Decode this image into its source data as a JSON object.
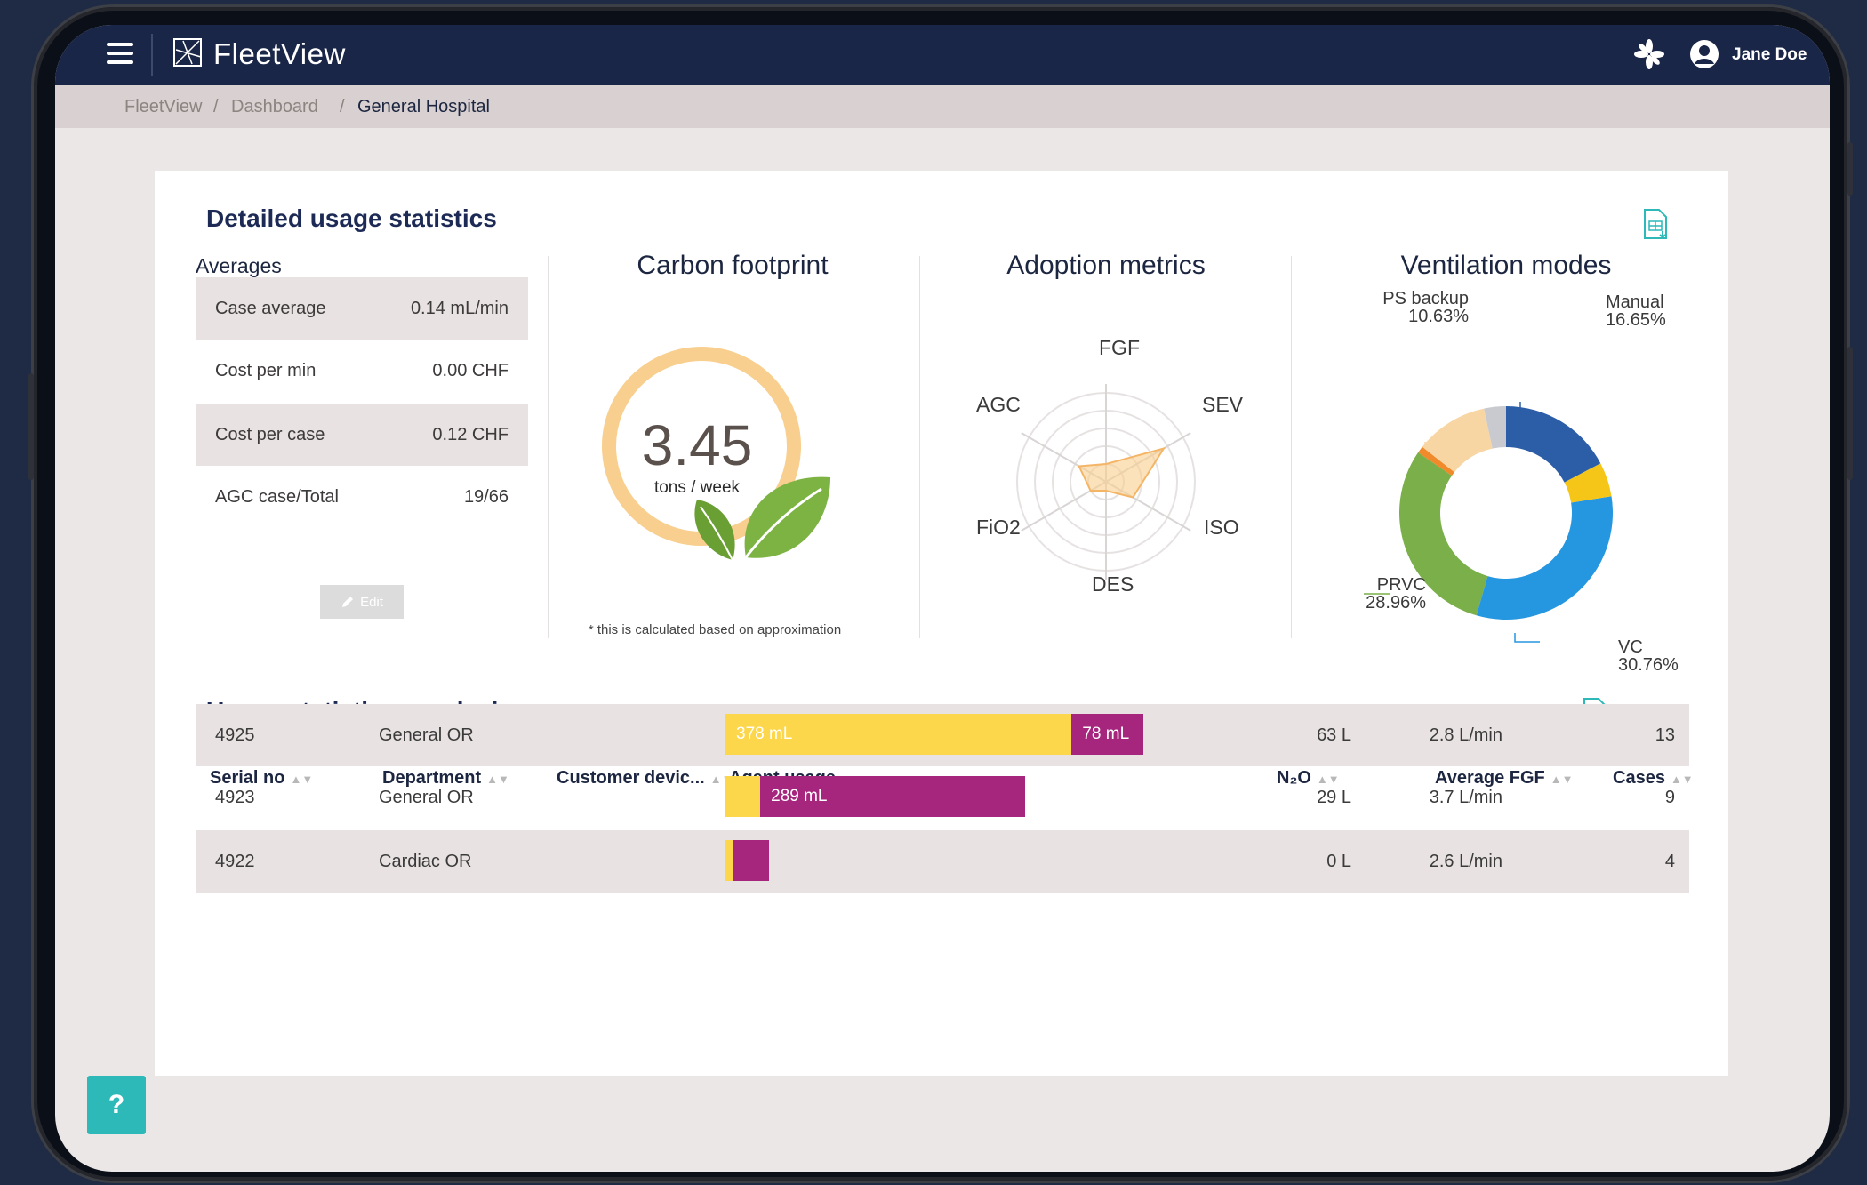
{
  "app": {
    "title": "FleetView",
    "user_name": "Jane Doe"
  },
  "breadcrumb": {
    "items": [
      "FleetView",
      "Dashboard",
      "General Hospital"
    ],
    "separator": "/"
  },
  "detailed": {
    "title": "Detailed usage statistics",
    "averages": {
      "heading": "Averages",
      "rows": [
        {
          "label": "Case average",
          "value": "0.14 mL/min"
        },
        {
          "label": "Cost per min",
          "value": "0.00 CHF"
        },
        {
          "label": "Cost per case",
          "value": "0.12 CHF"
        },
        {
          "label": "AGC case/Total",
          "value": "19/66"
        }
      ],
      "edit_label": "Edit"
    },
    "carbon": {
      "title": "Carbon footprint",
      "value": "3.45",
      "unit": "tons / week",
      "note": "* this is calculated based on approximation"
    },
    "adoption": {
      "title": "Adoption metrics",
      "axes": [
        "FGF",
        "SEV",
        "ISO",
        "DES",
        "FiO2",
        "AGC"
      ],
      "values": [
        0.2,
        0.75,
        0.35,
        0.1,
        0.2,
        0.35
      ]
    },
    "ventilation": {
      "title": "Ventilation modes",
      "slices": [
        {
          "name": "Manual",
          "pct": "16.65%",
          "value": 16.65,
          "color": "#2c5ea8"
        },
        {
          "name": "",
          "pct": "",
          "value": 5.0,
          "color": "#f5c518"
        },
        {
          "name": "VC",
          "pct": "30.76%",
          "value": 30.76,
          "color": "#2596e0"
        },
        {
          "name": "PRVC",
          "pct": "28.96%",
          "value": 28.96,
          "color": "#7aaf4a"
        },
        {
          "name": "",
          "pct": "",
          "value": 1.0,
          "color": "#f08a2a"
        },
        {
          "name": "PS backup",
          "pct": "10.63%",
          "value": 10.63,
          "color": "#f8d6a3"
        },
        {
          "name": "",
          "pct": "",
          "value": 3.2,
          "color": "#c9c9d0"
        }
      ]
    }
  },
  "per_device": {
    "title": "Usage statistics per device",
    "columns": [
      "Serial no",
      "Department",
      "Customer devic...",
      "Agent usage",
      "N₂O",
      "Average FGF",
      "Cases"
    ],
    "rows": [
      {
        "serial": "4925",
        "department": "General OR",
        "customer": "",
        "agent_yellow": "378 mL",
        "agent_purple": "78 mL",
        "yellow_ml": 378,
        "purple_ml": 78,
        "n2o": "63 L",
        "avg_fgf": "2.8 L/min",
        "cases": "13"
      },
      {
        "serial": "4923",
        "department": "General OR",
        "customer": "",
        "agent_yellow": "",
        "agent_purple": "289 mL",
        "yellow_ml": 38,
        "purple_ml": 289,
        "n2o": "29 L",
        "avg_fgf": "3.7 L/min",
        "cases": "9"
      },
      {
        "serial": "4922",
        "department": "Cardiac OR",
        "customer": "",
        "agent_yellow": "",
        "agent_purple": "",
        "yellow_ml": 8,
        "purple_ml": 40,
        "n2o": "0 L",
        "avg_fgf": "2.6 L/min",
        "cases": "4"
      }
    ]
  },
  "help": {
    "label": "?"
  },
  "colors": {
    "nav": "#1a2648",
    "agent_yellow": "#fcd64b",
    "agent_purple": "#a6267e",
    "teal": "#2cb9b8",
    "ring": "#f8cf8e",
    "leaf": "#7cb342"
  }
}
